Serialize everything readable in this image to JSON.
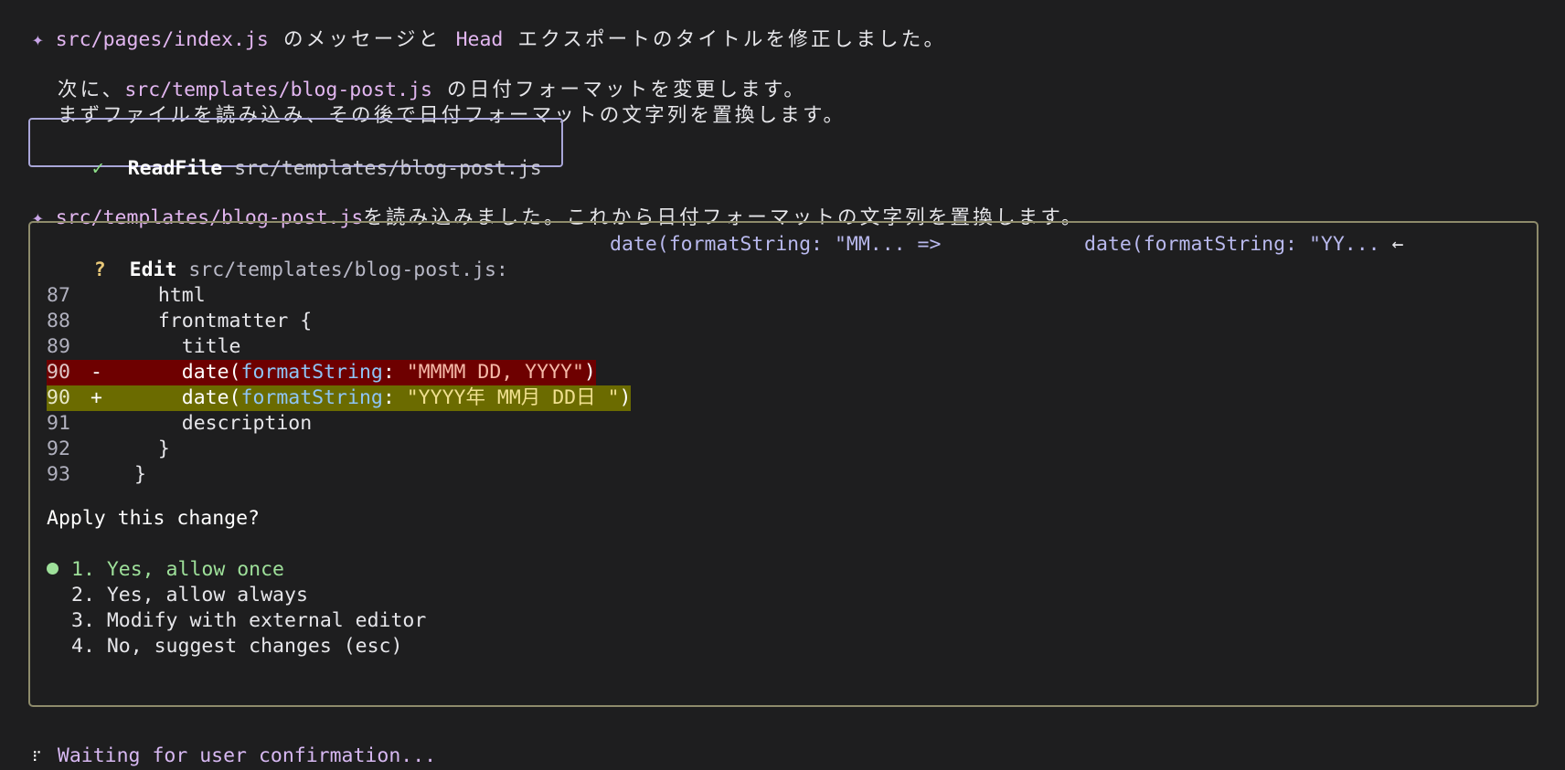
{
  "messages": {
    "line1": {
      "star": "✦",
      "path": "src/pages/index.js",
      "text_a": " のメッセージと ",
      "head": "Head",
      "text_b": " エクスポートのタイトルを修正しました。"
    },
    "line2": {
      "text_a": "次に、",
      "path": "src/templates/blog-post.js",
      "text_b": " の日付フォーマットを変更します。"
    },
    "line3": {
      "text": "まずファイルを読み込み、その後で日付フォーマットの文字列を置換します。"
    },
    "line4": {
      "star": "✦",
      "path": "src/templates/blog-post.js",
      "text": "を読み込みました。これから日付フォーマットの文字列を置換します。"
    }
  },
  "readfile": {
    "check": "✓",
    "label": "ReadFile",
    "path": "src/templates/blog-post.js"
  },
  "edit": {
    "question_mark": "?",
    "label": "Edit",
    "path": "src/templates/blog-post.js:",
    "old_preview": "date(formatString: \"MM... =>",
    "new_preview": "date(formatString: \"YY...",
    "arrow": "←",
    "code_lines": [
      {
        "num": "87",
        "sign": "",
        "code": "  html"
      },
      {
        "num": "88",
        "sign": "",
        "code": "  frontmatter {"
      },
      {
        "num": "89",
        "sign": "",
        "code": "    title"
      },
      {
        "num": "90",
        "sign": "-",
        "code_a": "    date(",
        "attr": "formatString",
        "code_b": ": ",
        "str": "\"MMMM DD, YYYY\"",
        "code_c": ")"
      },
      {
        "num": "90",
        "sign": "+",
        "code_a": "    date(",
        "attr": "formatString",
        "code_b": ": ",
        "str": "\"YYYY年 MM月 DD日 \"",
        "code_c": ")"
      },
      {
        "num": "91",
        "sign": "",
        "code": "    description"
      },
      {
        "num": "92",
        "sign": "",
        "code": "  }"
      },
      {
        "num": "93",
        "sign": "",
        "code": "}"
      }
    ],
    "question": "Apply this change?",
    "options": [
      "1. Yes, allow once",
      "2. Yes, allow always",
      "3. Modify with external editor",
      "4. No, suggest changes (esc)"
    ]
  },
  "status": {
    "spinner": "⠏",
    "text": "Waiting for user confirmation..."
  }
}
